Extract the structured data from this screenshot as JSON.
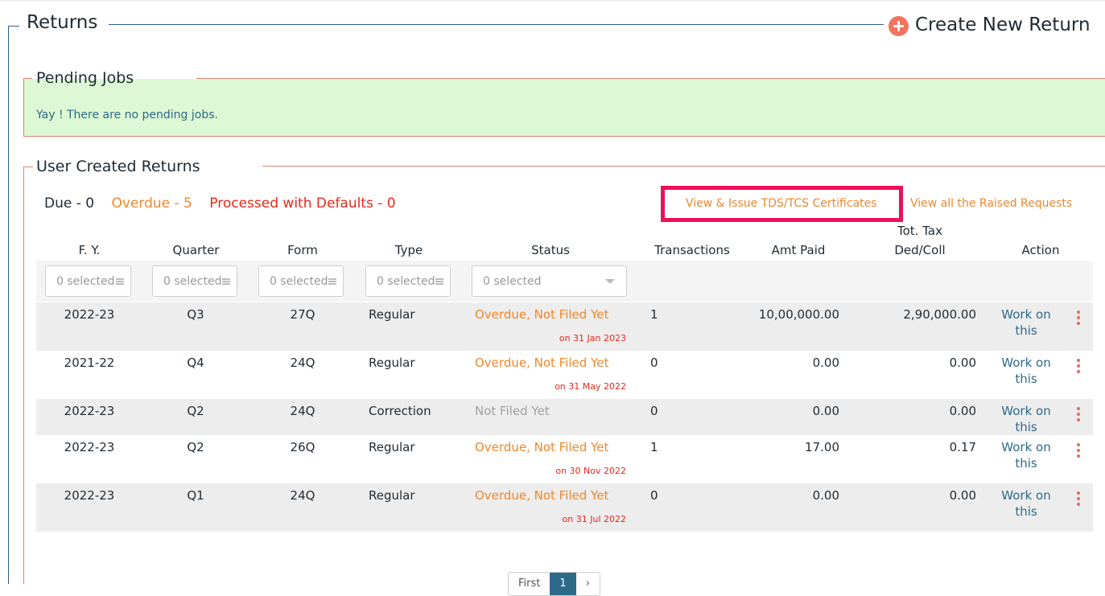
{
  "returns": {
    "title": "Returns",
    "create_label": "Create New Return"
  },
  "pending": {
    "title": "Pending Jobs",
    "message": "Yay ! There are no pending jobs."
  },
  "ucr": {
    "title": "User Created Returns",
    "due": "Due - 0",
    "overdue": "Overdue - 5",
    "defaults": "Processed with Defaults - 0",
    "cert_link": "View & Issue TDS/TCS Certificates",
    "raised_link": "View all the Raised Requests"
  },
  "table": {
    "headers": {
      "fy": "F. Y.",
      "quarter": "Quarter",
      "form": "Form",
      "type": "Type",
      "status": "Status",
      "transactions": "Transactions",
      "amt_paid": "Amt Paid",
      "tot_tax_1": "Tot. Tax",
      "tot_tax_2": "Ded/Coll",
      "action": "Action"
    },
    "filters": {
      "fy": "0 selected",
      "quarter": "0 selected",
      "form": "0 selected",
      "type": "0 selected",
      "status": "0 selected"
    },
    "rows": [
      {
        "fy": "2022-23",
        "quarter": "Q3",
        "form": "27Q",
        "type": "Regular",
        "status": "Overdue, Not Filed Yet",
        "due_date": "on 31 Jan 2023",
        "transactions": "1",
        "amt_paid": "10,00,000.00",
        "tot_tax": "2,90,000.00",
        "action_1": "Work on",
        "action_2": "this"
      },
      {
        "fy": "2021-22",
        "quarter": "Q4",
        "form": "24Q",
        "type": "Regular",
        "status": "Overdue, Not Filed Yet",
        "due_date": "on 31 May 2022",
        "transactions": "0",
        "amt_paid": "0.00",
        "tot_tax": "0.00",
        "action_1": "Work on",
        "action_2": "this"
      },
      {
        "fy": "2022-23",
        "quarter": "Q2",
        "form": "24Q",
        "type": "Correction",
        "status": "Not Filed Yet",
        "due_date": "",
        "transactions": "0",
        "amt_paid": "0.00",
        "tot_tax": "0.00",
        "action_1": "Work on",
        "action_2": "this"
      },
      {
        "fy": "2022-23",
        "quarter": "Q2",
        "form": "26Q",
        "type": "Regular",
        "status": "Overdue, Not Filed Yet",
        "due_date": "on 30 Nov 2022",
        "transactions": "1",
        "amt_paid": "17.00",
        "tot_tax": "0.17",
        "action_1": "Work on",
        "action_2": "this"
      },
      {
        "fy": "2022-23",
        "quarter": "Q1",
        "form": "24Q",
        "type": "Regular",
        "status": "Overdue, Not Filed Yet",
        "due_date": "on 31 Jul 2022",
        "transactions": "0",
        "amt_paid": "0.00",
        "tot_tax": "0.00",
        "action_1": "Work on",
        "action_2": "this"
      }
    ]
  },
  "pagination": {
    "first": "First",
    "current": "1",
    "next": "›"
  },
  "colors": {
    "overdue": "#f0862a",
    "defaults": "#e8261c",
    "highlight": "#ee0f5b",
    "pending_bg": "#dcf8d4",
    "link": "#2c6a8a"
  }
}
